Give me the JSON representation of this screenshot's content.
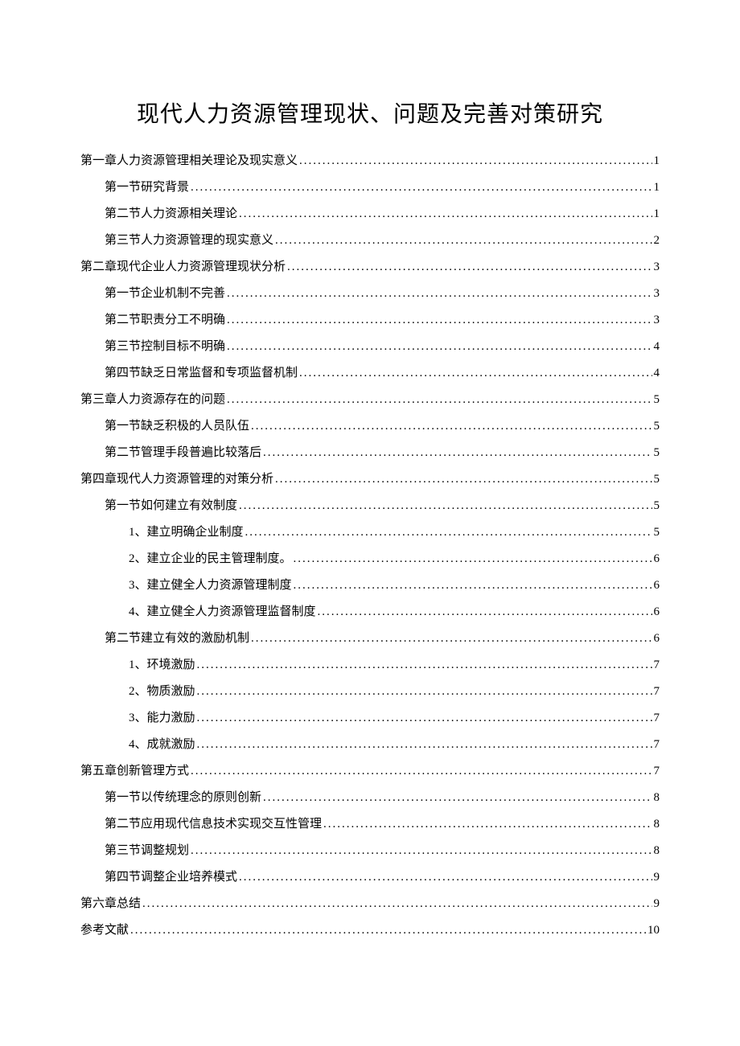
{
  "title": "现代人力资源管理现状、问题及完善对策研究",
  "toc": [
    {
      "level": 1,
      "label": "第一章人力资源管理相关理论及现实意义",
      "page": "1"
    },
    {
      "level": 2,
      "label": "第一节研究背景",
      "page": "1"
    },
    {
      "level": 2,
      "label": "第二节人力资源相关理论",
      "page": "1"
    },
    {
      "level": 2,
      "label": "第三节人力资源管理的现实意义",
      "page": "2"
    },
    {
      "level": 1,
      "label": "第二章现代企业人力资源管理现状分析",
      "page": "3"
    },
    {
      "level": 2,
      "label": "第一节企业机制不完善",
      "page": "3"
    },
    {
      "level": 2,
      "label": "第二节职责分工不明确",
      "page": "3"
    },
    {
      "level": 2,
      "label": "第三节控制目标不明确",
      "page": "4"
    },
    {
      "level": 2,
      "label": "第四节缺乏日常监督和专项监督机制",
      "page": "4"
    },
    {
      "level": 1,
      "label": "第三章人力资源存在的问题",
      "page": "5"
    },
    {
      "level": 2,
      "label": "第一节缺乏积极的人员队伍",
      "page": "5"
    },
    {
      "level": 2,
      "label": "第二节管理手段普遍比较落后",
      "page": "5"
    },
    {
      "level": 1,
      "label": "第四章现代人力资源管理的对策分析",
      "page": "5"
    },
    {
      "level": 2,
      "label": "第一节如何建立有效制度",
      "page": "5"
    },
    {
      "level": 3,
      "label": "1、建立明确企业制度",
      "page": "5"
    },
    {
      "level": 3,
      "label": "2、建立企业的民主管理制度。",
      "page": "6"
    },
    {
      "level": 3,
      "label": "3、建立健全人力资源管理制度",
      "page": "6"
    },
    {
      "level": 3,
      "label": "4、建立健全人力资源管理监督制度",
      "page": "6"
    },
    {
      "level": 2,
      "label": "第二节建立有效的激励机制",
      "page": "6"
    },
    {
      "level": 3,
      "label": "1、环境激励",
      "page": "7"
    },
    {
      "level": 3,
      "label": "2、物质激励",
      "page": "7"
    },
    {
      "level": 3,
      "label": "3、能力激励",
      "page": "7"
    },
    {
      "level": 3,
      "label": "4、成就激励",
      "page": "7"
    },
    {
      "level": 1,
      "label": "第五章创新管理方式",
      "page": "7"
    },
    {
      "level": 2,
      "label": "第一节以传统理念的原则创新",
      "page": "8"
    },
    {
      "level": 2,
      "label": "第二节应用现代信息技术实现交互性管理",
      "page": "8"
    },
    {
      "level": 2,
      "label": "第三节调整规划",
      "page": "8"
    },
    {
      "level": 2,
      "label": "第四节调整企业培养模式",
      "page": "9"
    },
    {
      "level": 1,
      "label": "第六章总结",
      "page": "9"
    },
    {
      "level": 1,
      "label": "参考文献",
      "page": "10"
    }
  ]
}
